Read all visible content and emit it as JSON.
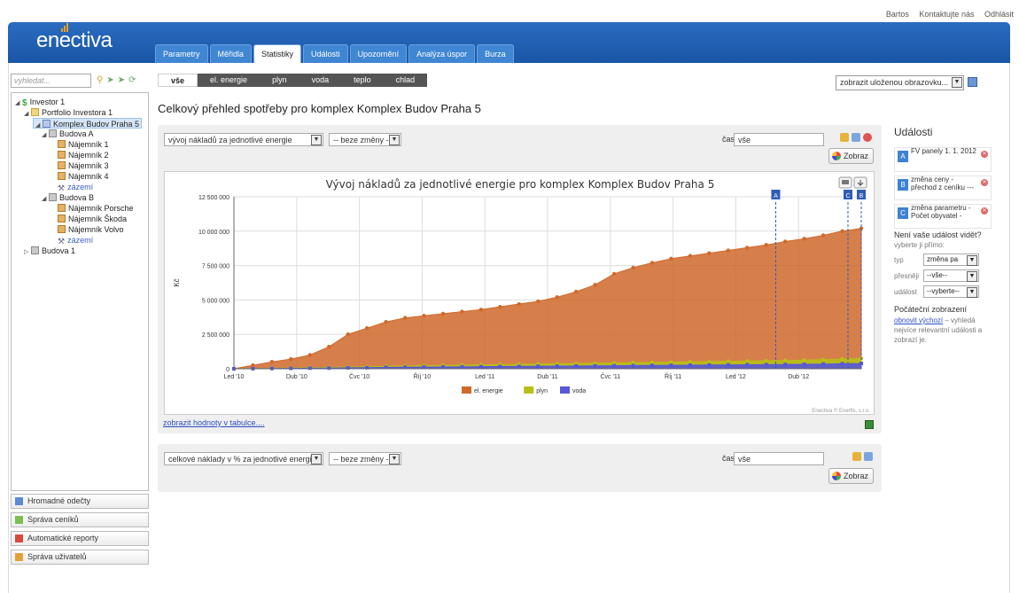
{
  "top_links": [
    "Bartos",
    "Kontaktujte nás",
    "Odhlásit"
  ],
  "logo": "enectiva",
  "tabs": [
    {
      "label": "Parametry",
      "active": false
    },
    {
      "label": "Měřidla",
      "active": false
    },
    {
      "label": "Statistiky",
      "active": true
    },
    {
      "label": "Události",
      "active": false
    },
    {
      "label": "Upozornění",
      "active": false
    },
    {
      "label": "Analýza úspor",
      "active": false
    },
    {
      "label": "Burza",
      "active": false
    }
  ],
  "search": {
    "placeholder": "vyhledat..."
  },
  "tree": [
    {
      "label": "Investor 1",
      "icon": "investor-icon",
      "depth": 0,
      "expand": "open"
    },
    {
      "label": "Portfolio Investora 1",
      "icon": "portfolio-icon",
      "depth": 1,
      "expand": "open"
    },
    {
      "label": "Komplex Budov Praha 5",
      "icon": "complex-icon",
      "depth": 2,
      "expand": "open",
      "selected": true
    },
    {
      "label": "Budova A",
      "icon": "building-icon",
      "depth": 3,
      "expand": "open"
    },
    {
      "label": "Nájemník 1",
      "icon": "tenant-icon",
      "depth": 4
    },
    {
      "label": "Nájemník 2",
      "icon": "tenant-icon",
      "depth": 4
    },
    {
      "label": "Nájemník 3",
      "icon": "tenant-icon",
      "depth": 4
    },
    {
      "label": "Nájemník 4",
      "icon": "tenant-icon",
      "depth": 4
    },
    {
      "label": "zázemí",
      "icon": "tool-icon",
      "depth": 4,
      "link": true
    },
    {
      "label": "Budova B",
      "icon": "building-icon",
      "depth": 3,
      "expand": "open"
    },
    {
      "label": "Nájemník Porsche",
      "icon": "tenant-icon",
      "depth": 4
    },
    {
      "label": "Nájemník Škoda",
      "icon": "tenant-icon",
      "depth": 4
    },
    {
      "label": "Nájemník Volvo",
      "icon": "tenant-icon",
      "depth": 4
    },
    {
      "label": "zázemí",
      "icon": "tool-icon",
      "depth": 4,
      "link": true
    },
    {
      "label": "Budova 1",
      "icon": "building-icon",
      "depth": 1,
      "expand": "closed"
    }
  ],
  "side_buttons": [
    {
      "label": "Hromadné odečty",
      "color": "#5b8ad6"
    },
    {
      "label": "Správa ceníků",
      "color": "#7cbf4f"
    },
    {
      "label": "Automatické reporty",
      "color": "#d94a3c"
    },
    {
      "label": "Správa uživatelů",
      "color": "#e2a13a"
    }
  ],
  "filter_tabs": [
    {
      "label": "vše",
      "active": true
    },
    {
      "label": "el. energie"
    },
    {
      "label": "plyn"
    },
    {
      "label": "voda"
    },
    {
      "label": "teplo"
    },
    {
      "label": "chlad"
    }
  ],
  "saved_view": "zobrazit uloženou obrazovku...",
  "page_title": "Celkový přehled spotřeby pro komplex Komplex Budov Praha 5",
  "panel1": {
    "select1": "vývoj nákladů za jednotlivé energie",
    "select2": "-- beze změny -",
    "time_label": "čas",
    "time_value": "vše",
    "zobraz": "Zobraz",
    "table_link": "zobrazit hodnoty v tabulce....",
    "credit": "Enectiva © Enerfis, s.r.o."
  },
  "panel2": {
    "select1": "celkové náklady v % za jednotlivé energie",
    "select2": "-- beze změny -",
    "time_label": "čas",
    "time_value": "vše",
    "zobraz": "Zobraz"
  },
  "chart_data": {
    "type": "area",
    "title": "Vývoj nákladů za jednotlivé energie pro komplex Komplex Budov Praha 5",
    "ylabel": "Kč",
    "ylim": [
      0,
      12500000
    ],
    "yticks": [
      "0",
      "2 500 000",
      "5 000 000",
      "7 500 000",
      "10 000 000",
      "12 500 000"
    ],
    "xticks": [
      "Led '10",
      "Dub '10",
      "Čvc '10",
      "Říj '10",
      "Led '11",
      "Dub '11",
      "Čvc '11",
      "Říj '11",
      "Led '12",
      "Dub '12"
    ],
    "grid": true,
    "legend_position": "bottom",
    "series": [
      {
        "name": "el. energie",
        "color": "#d0692b",
        "values": [
          0,
          250000,
          500000,
          700000,
          1000000,
          1600000,
          2500000,
          2950000,
          3400000,
          3700000,
          3850000,
          4000000,
          4150000,
          4300000,
          4500000,
          4700000,
          4900000,
          5200000,
          5600000,
          6100000,
          6900000,
          7350000,
          7700000,
          8000000,
          8200000,
          8400000,
          8600000,
          8800000,
          9000000,
          9250000,
          9450000,
          9700000,
          10000000,
          10200000
        ]
      },
      {
        "name": "plyn",
        "color": "#b8bf16",
        "values": [
          0,
          20000,
          40000,
          60000,
          80000,
          100000,
          120000,
          150000,
          180000,
          200000,
          220000,
          240000,
          260000,
          280000,
          300000,
          320000,
          340000,
          360000,
          380000,
          400000,
          420000,
          440000,
          460000,
          480000,
          500000,
          520000,
          540000,
          560000,
          580000,
          600000,
          630000,
          660000,
          700000,
          750000
        ]
      },
      {
        "name": "voda",
        "color": "#5757d9",
        "values": [
          0,
          10000,
          20000,
          30000,
          40000,
          50000,
          70000,
          80000,
          100000,
          110000,
          120000,
          130000,
          140000,
          150000,
          160000,
          170000,
          180000,
          190000,
          200000,
          210000,
          220000,
          230000,
          240000,
          250000,
          260000,
          270000,
          280000,
          290000,
          300000,
          310000,
          320000,
          340000,
          360000,
          380000
        ]
      }
    ],
    "events": [
      {
        "label": "A",
        "x_index": 28.5
      },
      {
        "label": "C",
        "x_index": 32.3
      },
      {
        "label": "B",
        "x_index": 33.0
      }
    ]
  },
  "events": {
    "title": "Události",
    "items": [
      {
        "badge": "A",
        "text": "FV panely 1. 1. 2012"
      },
      {
        "badge": "B",
        "text": "změna ceny - přechod z ceníku ---"
      },
      {
        "badge": "C",
        "text": "změna parametru - Počet obyvatel -"
      }
    ],
    "not_visible": "Není vaše událost vidět?",
    "pick_direct": "vyberte ji přímo:",
    "filters": [
      {
        "label": "typ",
        "value": "změna pa"
      },
      {
        "label": "přesněji",
        "value": "--vše--"
      },
      {
        "label": "událost",
        "value": "--vyberte--"
      }
    ],
    "initial_title": "Počáteční zobrazení",
    "initial_link": "obnovit výchozí",
    "initial_text": "– vyhledá nejvíce relevantní události a zobrazí je."
  }
}
